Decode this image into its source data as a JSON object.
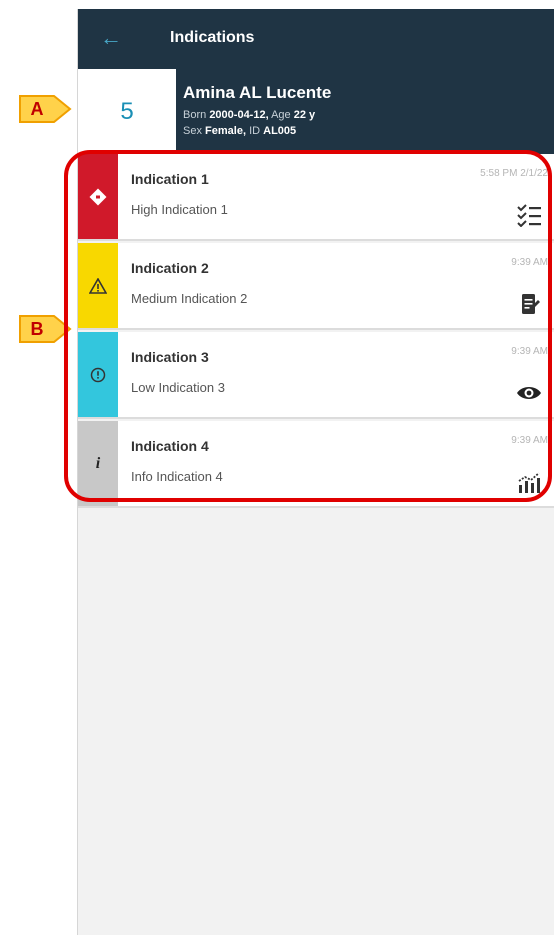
{
  "appbar": {
    "title": "Indications"
  },
  "patient": {
    "bed": "5",
    "name": "Amina AL Lucente",
    "born_label": "Born",
    "born": "2000-04-12,",
    "age_label": "Age",
    "age": "22 y",
    "sex_label": "Sex",
    "sex": "Female,",
    "id_label": "ID",
    "id": "AL005"
  },
  "indications": [
    {
      "title": "Indication 1",
      "subtitle": "High Indication 1",
      "time": "5:58 PM 2/1/22",
      "severity": "high",
      "color": "#d0192a",
      "icon": "checklist-icon"
    },
    {
      "title": "Indication 2",
      "subtitle": "Medium Indication 2",
      "time": "9:39 AM",
      "severity": "medium",
      "color": "#f8d800",
      "icon": "notepad-icon"
    },
    {
      "title": "Indication 3",
      "subtitle": "Low Indication 3",
      "time": "9:39 AM",
      "severity": "low",
      "color": "#33c6dd",
      "icon": "eye-icon"
    },
    {
      "title": "Indication 4",
      "subtitle": "Info Indication 4",
      "time": "9:39 AM",
      "severity": "info",
      "color": "#c8c8c8",
      "icon": "chart-icon"
    }
  ],
  "annotations": {
    "a": "A",
    "b": "B"
  },
  "colors": {
    "header": "#1f3444",
    "accent": "#1a8fb5",
    "annotation": "#e00000"
  }
}
